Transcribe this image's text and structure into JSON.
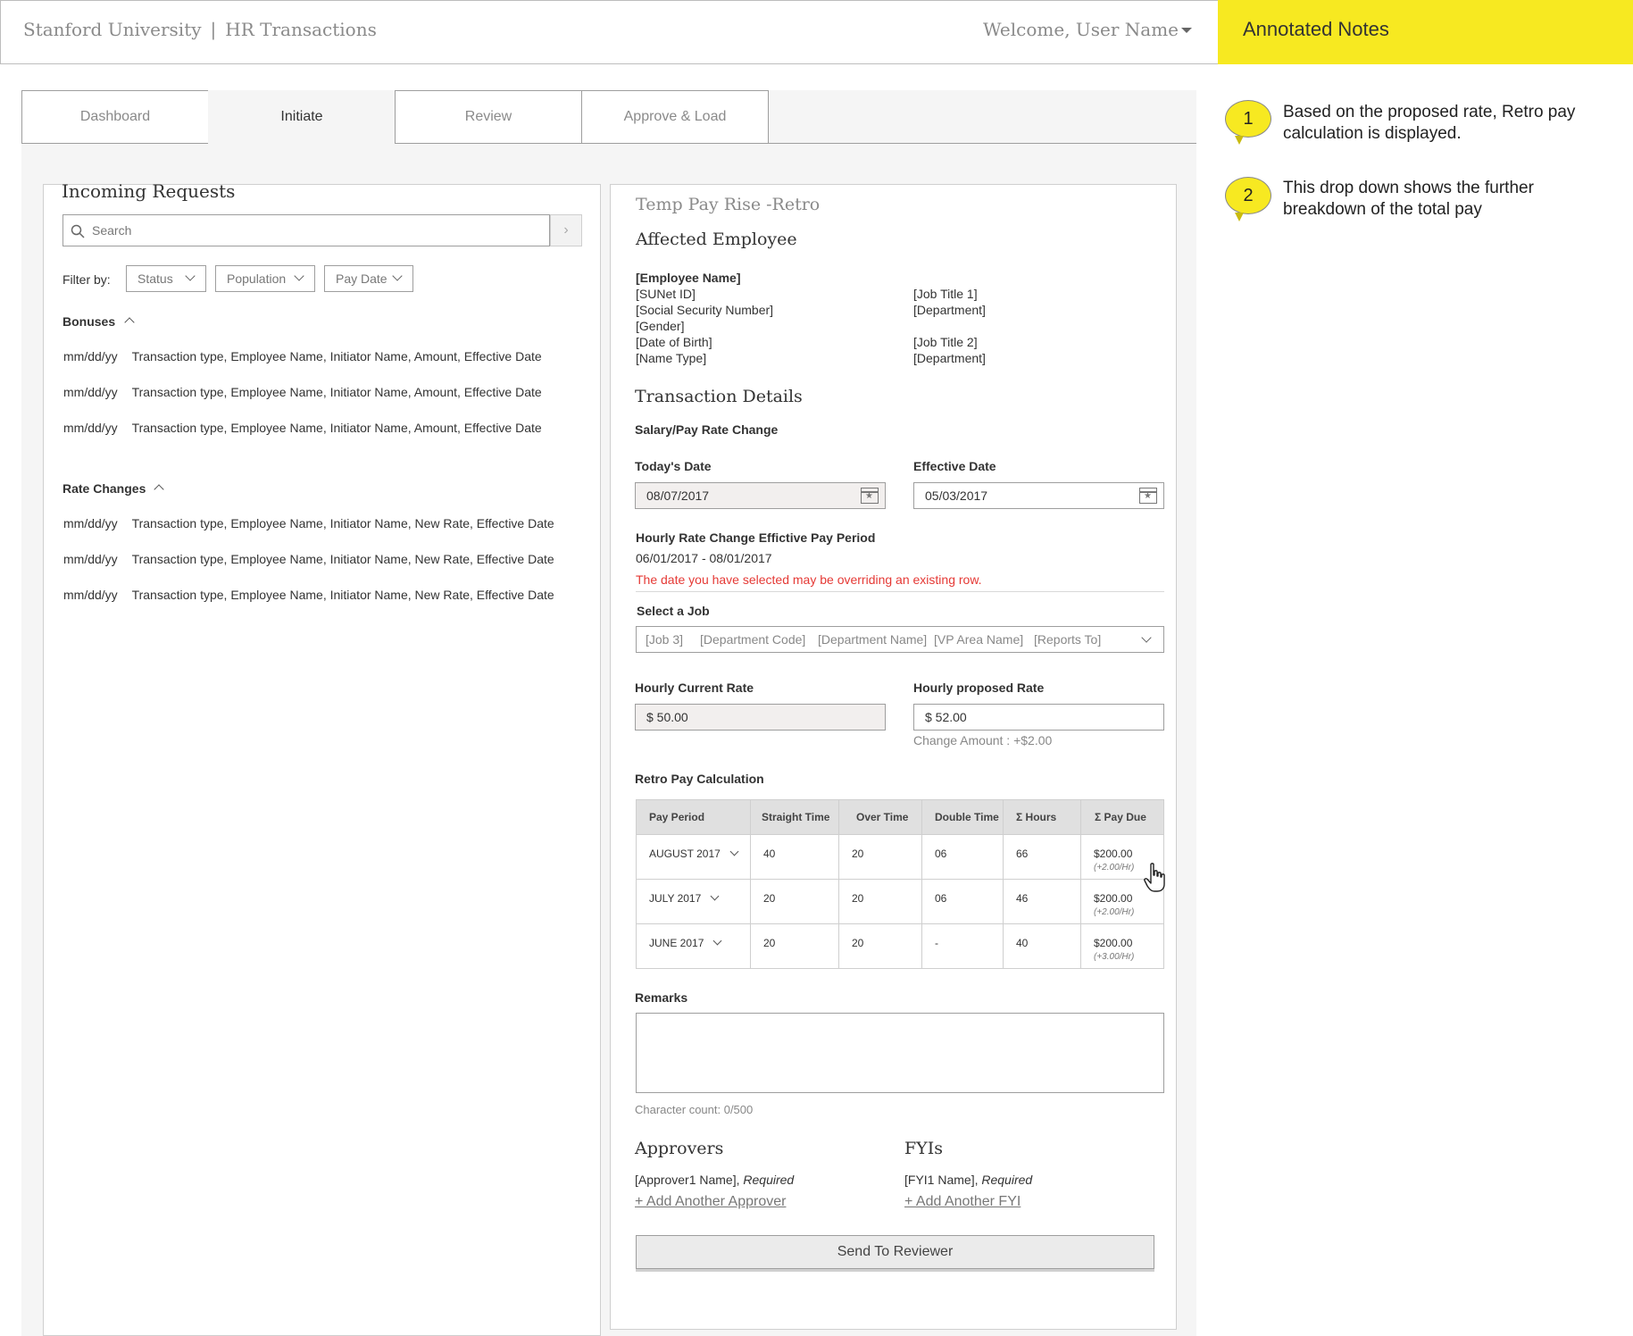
{
  "header": {
    "org": "Stanford University",
    "separator": "|",
    "app": "HR Transactions",
    "welcome": "Welcome, User Name"
  },
  "tabs": [
    {
      "label": "Dashboard",
      "active": false
    },
    {
      "label": "Initiate",
      "active": true
    },
    {
      "label": "Review",
      "active": false
    },
    {
      "label": "Approve & Load",
      "active": false
    }
  ],
  "notes": {
    "title": "Annotated Notes",
    "items": [
      {
        "num": "1",
        "text": "Based on the proposed rate, Retro pay calculation is displayed."
      },
      {
        "num": "2",
        "text": "This drop down shows the further breakdown of the total pay"
      }
    ],
    "color": "#f7e921"
  },
  "incoming": {
    "title": "Incoming Requests",
    "search_placeholder": "Search",
    "filter_label": "Filter by:",
    "filters": [
      "Status",
      "Population",
      "Pay Date"
    ],
    "bonuses": {
      "label": "Bonuses",
      "rows": [
        {
          "date": "mm/dd/yy",
          "desc": "Transaction type, Employee Name, Initiator Name, Amount, Effective Date"
        },
        {
          "date": "mm/dd/yy",
          "desc": "Transaction type, Employee Name, Initiator Name, Amount, Effective Date"
        },
        {
          "date": "mm/dd/yy",
          "desc": "Transaction type, Employee Name, Initiator Name, Amount, Effective Date"
        }
      ]
    },
    "rate_changes": {
      "label": "Rate Changes",
      "rows": [
        {
          "date": "mm/dd/yy",
          "desc": "Transaction type, Employee Name, Initiator Name, New Rate, Effective Date"
        },
        {
          "date": "mm/dd/yy",
          "desc": "Transaction type, Employee Name, Initiator Name, New Rate, Effective Date"
        },
        {
          "date": "mm/dd/yy",
          "desc": "Transaction type, Employee Name, Initiator Name, New Rate, Effective Date"
        }
      ]
    }
  },
  "form": {
    "title": "Temp Pay Rise -Retro",
    "affected_employee": {
      "heading": "Affected Employee",
      "name": "[Employee Name]",
      "left": [
        "[SUNet ID]",
        "[Social Security Number]",
        "[Gender]",
        "[Date of Birth]",
        "[Name Type]"
      ],
      "right": [
        "[Job Title 1]",
        "[Department]",
        "[Job Title 2]",
        "[Department]"
      ]
    },
    "transaction": {
      "heading": "Transaction Details",
      "subheading": "Salary/Pay Rate Change",
      "todays_date_label": "Today's Date",
      "todays_date": "08/07/2017",
      "effective_date_label": "Effective Date",
      "effective_date": "05/03/2017",
      "period_label": "Hourly Rate Change Effictive Pay Period",
      "period": "06/01/2017 - 08/01/2017",
      "warning": "The date you have selected may be overriding an existing row.",
      "warning_color": "#e53935",
      "job_label": "Select a Job",
      "job_fields": [
        "[Job 3]",
        "[Department Code]",
        "[Department Name]",
        "[VP Area Name]",
        "[Reports To]"
      ],
      "current_rate_label": "Hourly Current  Rate",
      "current_rate": "$ 50.00",
      "proposed_rate_label": "Hourly proposed Rate",
      "proposed_rate": "$ 52.00",
      "change_amount": "Change Amount : +$2.00"
    },
    "retro": {
      "heading": "Retro Pay Calculation",
      "columns": [
        "Pay Period",
        "Straight Time",
        "Over Time",
        "Double Time",
        "Σ  Hours",
        "Σ  Pay Due"
      ],
      "rows": [
        {
          "period": "AUGUST 2017",
          "straight": "40",
          "over": "20",
          "double": "06",
          "hours": "66",
          "pay": "$200.00",
          "rate": "(+2.00/Hr)"
        },
        {
          "period": "JULY 2017",
          "straight": "20",
          "over": "20",
          "double": "06",
          "hours": "46",
          "pay": "$200.00",
          "rate": "(+2.00/Hr)"
        },
        {
          "period": "JUNE 2017",
          "straight": "20",
          "over": "20",
          "double": "-",
          "hours": "40",
          "pay": "$200.00",
          "rate": "(+3.00/Hr)"
        }
      ]
    },
    "remarks": {
      "label": "Remarks",
      "char_count": "Character count: 0/500"
    },
    "approvers": {
      "heading": "Approvers",
      "name": "[Approver1 Name],",
      "required": "Required",
      "add": "+ Add Another Approver"
    },
    "fyis": {
      "heading": "FYIs",
      "name": "[FYI1 Name],",
      "required": "Required",
      "add": "+ Add Another FYI"
    },
    "send_button": "Send To Reviewer"
  }
}
